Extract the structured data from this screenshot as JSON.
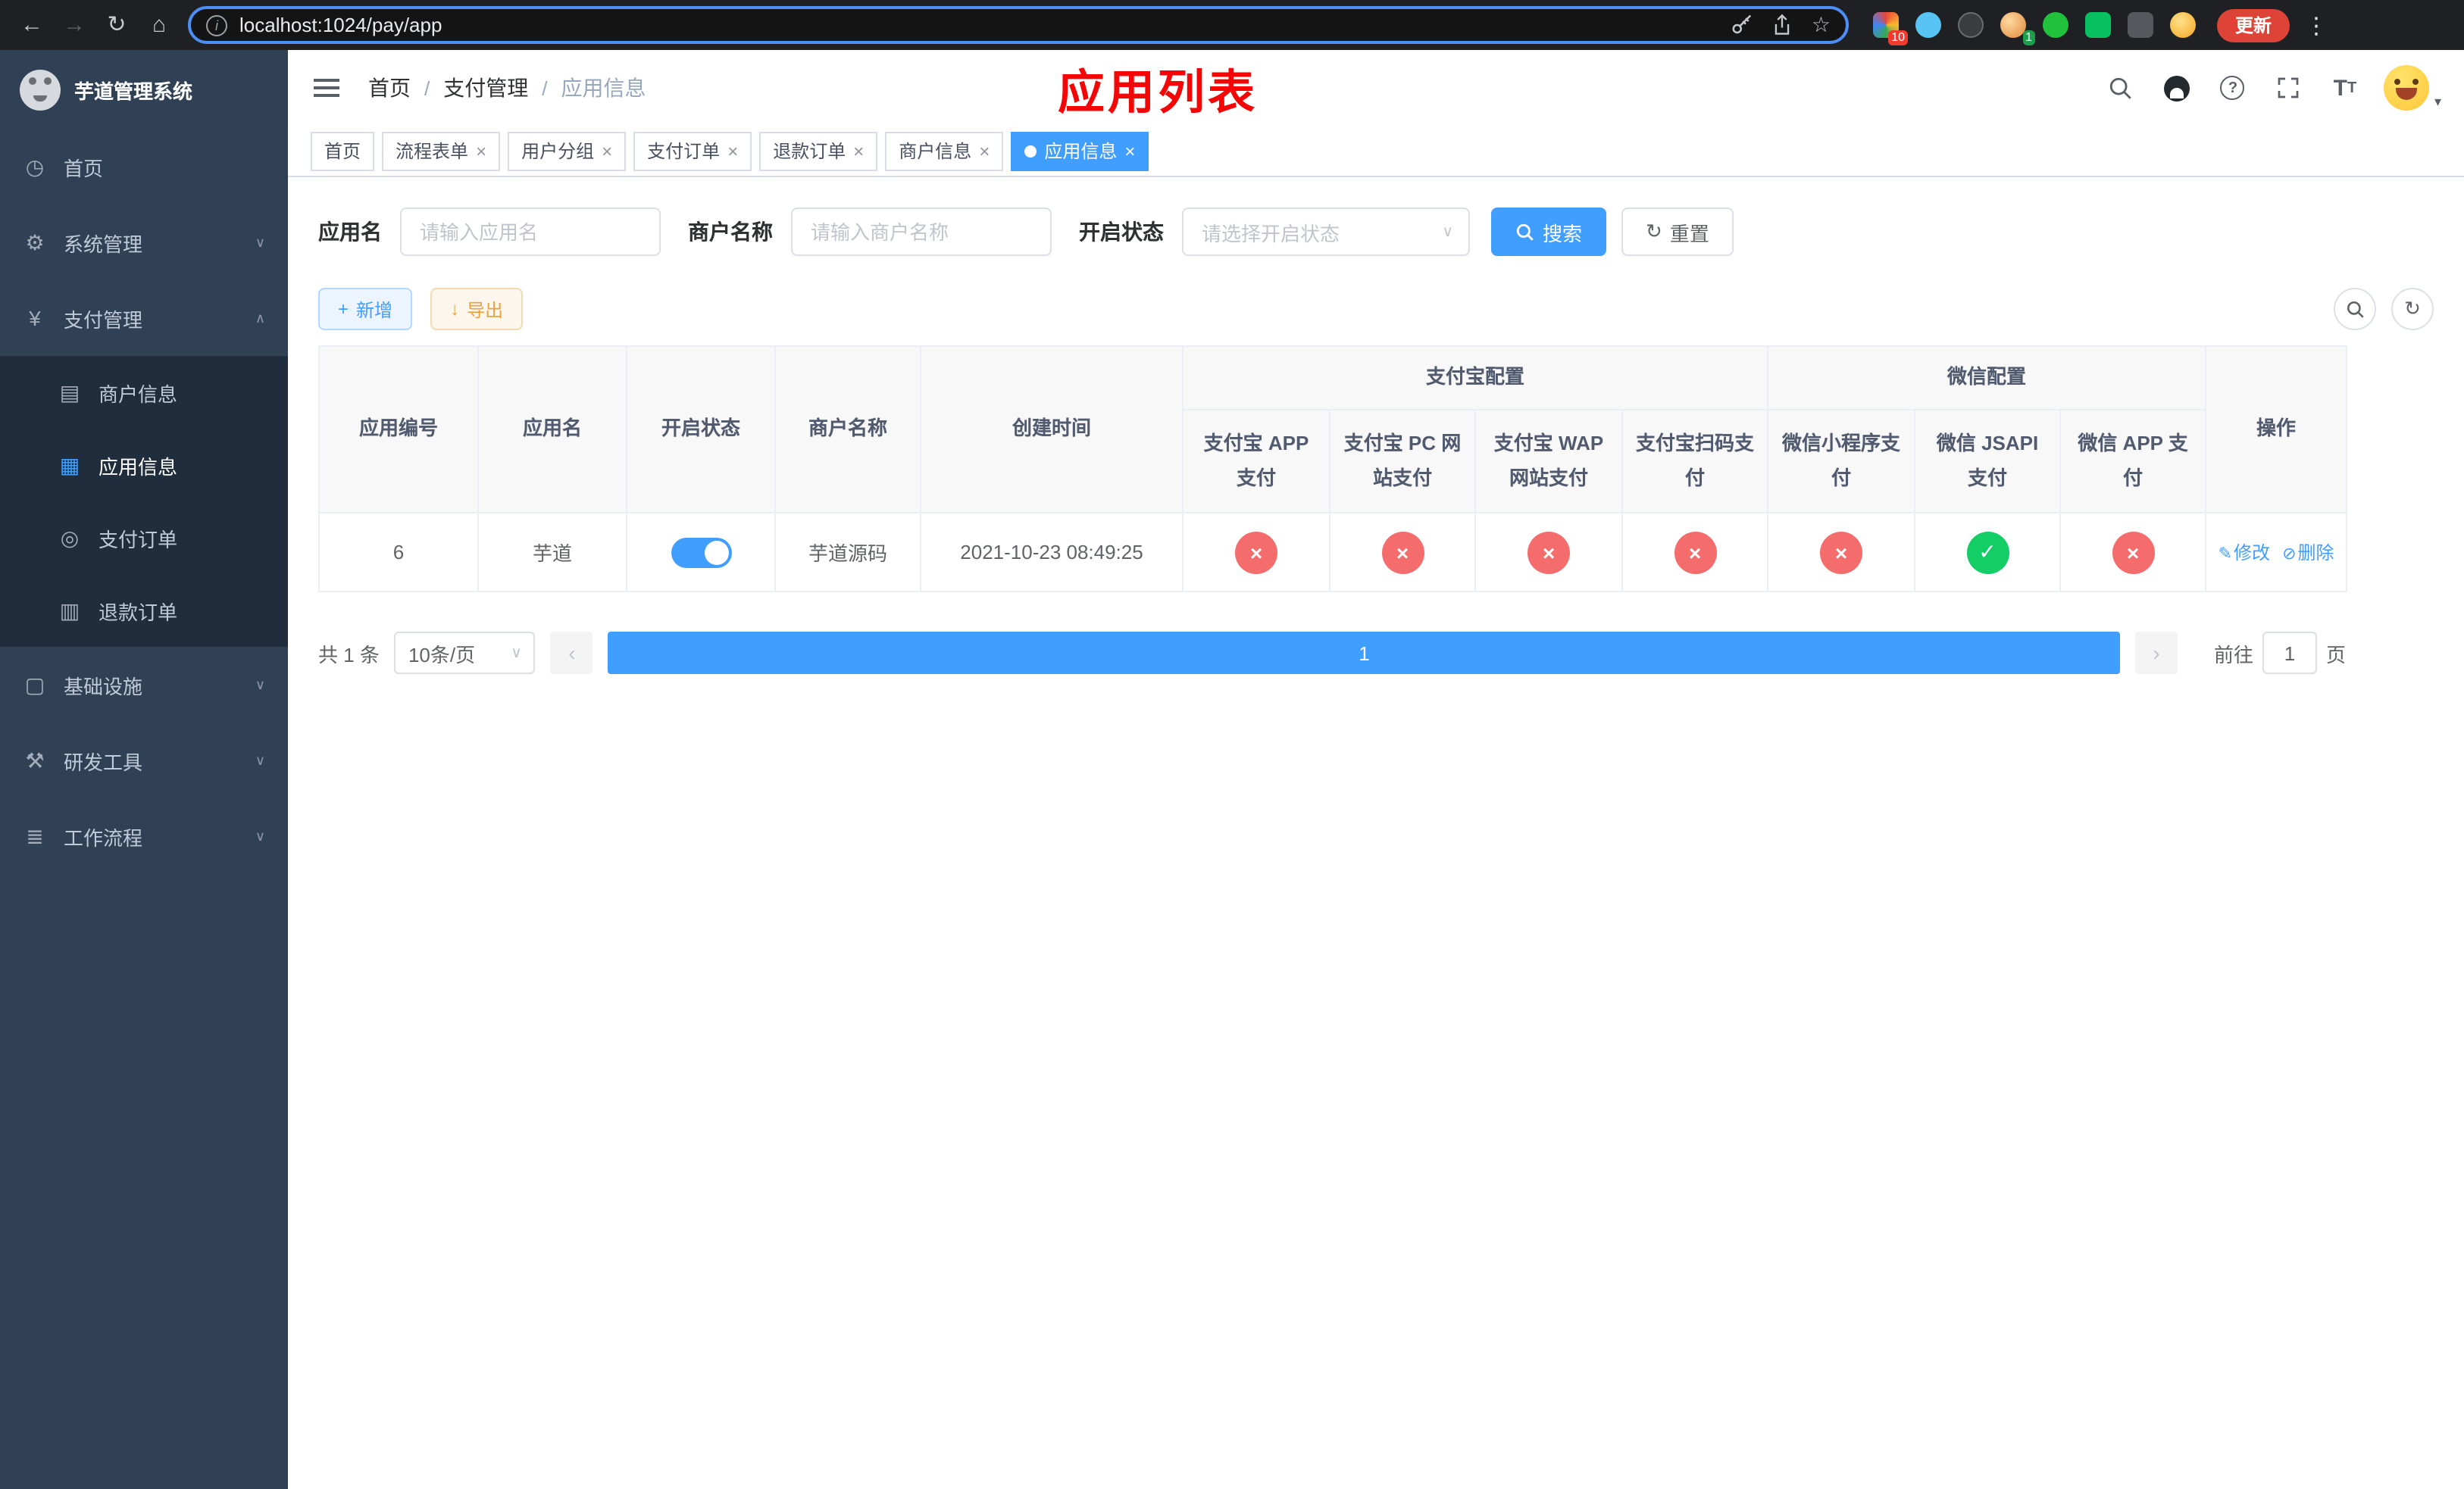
{
  "browser": {
    "url": "localhost:1024/pay/app",
    "update_button": "更新",
    "extension_badge_grid": "10",
    "extension_badge_avatar": "1"
  },
  "icons": {
    "back": "←",
    "forward": "→",
    "reload": "↻",
    "home": "⌂",
    "info": "i",
    "star": "☆",
    "dots": "⋮",
    "close": "×",
    "caret_down": "∨",
    "chevron_down": "∨",
    "chevron_up": "∧",
    "plus": "+",
    "download": "↓",
    "refresh": "↻",
    "prev": "‹",
    "next": "›",
    "font_big": "T",
    "font_small": "T",
    "question": "?",
    "avatar_caret": "▾",
    "menu": {
      "home": "◷",
      "system": "⚙",
      "pay": "¥",
      "merchant": "▤",
      "app": "▦",
      "order": "◎",
      "refund": "▥",
      "infra": "▢",
      "dev": "⚒",
      "flow": "≣"
    }
  },
  "sidebar": {
    "title": "芋道管理系统",
    "items": [
      {
        "label": "首页"
      },
      {
        "label": "系统管理"
      },
      {
        "label": "支付管理"
      },
      {
        "label": "基础设施"
      },
      {
        "label": "研发工具"
      },
      {
        "label": "工作流程"
      }
    ],
    "payment_submenu": [
      {
        "label": "商户信息"
      },
      {
        "label": "应用信息"
      },
      {
        "label": "支付订单"
      },
      {
        "label": "退款订单"
      }
    ]
  },
  "header": {
    "breadcrumb": [
      "首页",
      "支付管理",
      "应用信息"
    ],
    "separator": "/",
    "annotation": "应用列表"
  },
  "tabs": [
    {
      "label": "首页"
    },
    {
      "label": "流程表单"
    },
    {
      "label": "用户分组"
    },
    {
      "label": "支付订单"
    },
    {
      "label": "退款订单"
    },
    {
      "label": "商户信息"
    },
    {
      "label": "应用信息"
    }
  ],
  "filters": {
    "app_name": {
      "label": "应用名",
      "placeholder": "请输入应用名",
      "value": ""
    },
    "merchant_name": {
      "label": "商户名称",
      "placeholder": "请输入商户名称",
      "value": ""
    },
    "status": {
      "label": "开启状态",
      "placeholder": "请选择开启状态"
    },
    "search_button": "搜索",
    "reset_button": "重置"
  },
  "toolbar": {
    "add_button": "新增",
    "export_button": "导出"
  },
  "table": {
    "columns": {
      "app_id": "应用编号",
      "app_name": "应用名",
      "status": "开启状态",
      "merchant_name": "商户名称",
      "created_at": "创建时间",
      "alipay_group": "支付宝配置",
      "wechat_group": "微信配置",
      "alipay": [
        "支付宝 APP 支付",
        "支付宝 PC 网站支付",
        "支付宝 WAP 网站支付",
        "支付宝扫码支付"
      ],
      "wechat": [
        "微信小程序支付",
        "微信 JSAPI 支付",
        "微信 APP 支付"
      ],
      "actions": "操作"
    },
    "rows": [
      {
        "app_id": "6",
        "app_name": "芋道",
        "enabled": true,
        "merchant_name": "芋道源码",
        "created_at": "2021-10-23 08:49:25",
        "channels": [
          {
            "state": "disabled",
            "glyph": "×",
            "cls": "status-circle red"
          },
          {
            "state": "disabled",
            "glyph": "×",
            "cls": "status-circle red"
          },
          {
            "state": "disabled",
            "glyph": "×",
            "cls": "status-circle red"
          },
          {
            "state": "disabled",
            "glyph": "×",
            "cls": "status-circle red"
          },
          {
            "state": "disabled",
            "glyph": "×",
            "cls": "status-circle red"
          },
          {
            "state": "enabled",
            "glyph": "✓",
            "cls": "status-circle green"
          },
          {
            "state": "disabled",
            "glyph": "×",
            "cls": "status-circle red"
          }
        ],
        "edit_link": "修改",
        "delete_link": "删除",
        "edit_icon": "✎",
        "delete_icon": "⊘"
      }
    ]
  },
  "pagination": {
    "total": "共 1 条",
    "page_size": "10条/页",
    "current_page": "1",
    "goto_label": "前往",
    "goto_value": "1",
    "goto_unit": "页"
  },
  "colors": {
    "primary": "#409eff",
    "danger": "#f56c6c",
    "success": "#13ce66",
    "sidebar_bg": "#304156",
    "annotation": "#f40606"
  }
}
